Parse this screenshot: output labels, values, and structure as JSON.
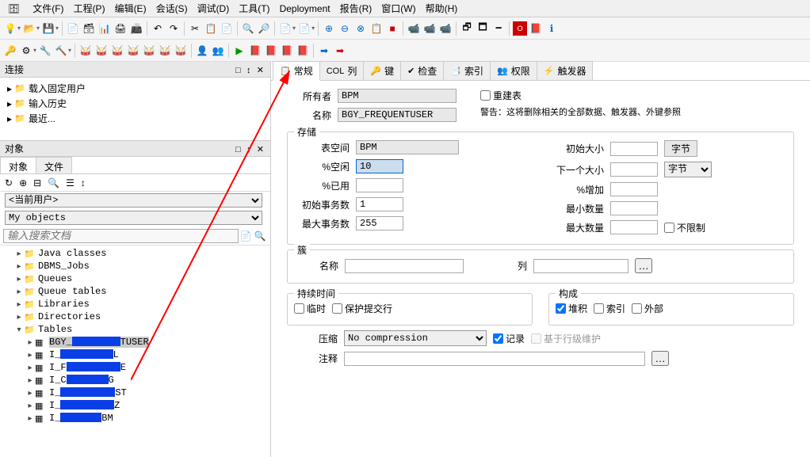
{
  "menus": [
    "文件(F)",
    "工程(P)",
    "编辑(E)",
    "会话(S)",
    "调试(D)",
    "工具(T)",
    "Deployment",
    "报告(R)",
    "窗口(W)",
    "帮助(H)"
  ],
  "panel_conn_title": "连接",
  "conn_items": [
    {
      "label": "载入固定用户"
    },
    {
      "label": "输入历史"
    },
    {
      "label": "最近..."
    }
  ],
  "obj_panel_title": "对象",
  "obj_tabs": [
    "对象",
    "文件"
  ],
  "obj_scope": "<当前用户>",
  "obj_myobjects": "My objects",
  "obj_search_ph": "输入搜索文档",
  "tree_top": [
    "Java classes",
    "DBMS_Jobs",
    "Queues",
    "Queue tables",
    "Libraries",
    "Directories"
  ],
  "tree_tables_label": "Tables",
  "tree_tables": [
    {
      "label": "BGY_",
      "tail": "TUSER",
      "sel": true
    },
    {
      "label": "I_",
      "tail": "L"
    },
    {
      "label": "I_F",
      "tail": "E"
    },
    {
      "label": "I_C",
      "tail": "G"
    },
    {
      "label": "I_",
      "tail": "ST"
    },
    {
      "label": "I_",
      "tail": "Z"
    },
    {
      "label": "I_",
      "tail": "BM"
    }
  ],
  "tabs": [
    {
      "icon": "📋",
      "label": "常规",
      "active": true
    },
    {
      "icon": "COL",
      "label": "列"
    },
    {
      "icon": "🔑",
      "label": "键"
    },
    {
      "icon": "✔",
      "label": "检查"
    },
    {
      "icon": "📑",
      "label": "索引"
    },
    {
      "icon": "👥",
      "label": "权限"
    },
    {
      "icon": "⚡",
      "label": "触发器"
    }
  ],
  "form": {
    "owner_lbl": "所有者",
    "owner_val": "BPM",
    "name_lbl": "名称",
    "name_val": "BGY_FREQUENTUSER",
    "rebuild_lbl": "重建表",
    "warn": "警告：这将删除相关的全部数据、触发器、外键参照",
    "storage_lbl": "存储",
    "tablespace_lbl": "表空间",
    "tablespace_val": "BPM",
    "initsize_lbl": "初始大小",
    "initsize_unit": "字节",
    "free_lbl": "%空闲",
    "free_val": "10",
    "next_lbl": "下一个大小",
    "next_unit": "字节",
    "used_lbl": "%已用",
    "incr_lbl": "%增加",
    "inittx_lbl": "初始事务数",
    "inittx_val": "1",
    "minext_lbl": "最小数量",
    "maxtx_lbl": "最大事务数",
    "maxtx_val": "255",
    "maxext_lbl": "最大数量",
    "unlimited_lbl": "不限制",
    "cluster_lbl": "簇",
    "cluster_name_lbl": "名称",
    "cluster_col_lbl": "列",
    "duration_lbl": "持续时间",
    "temp_lbl": "临时",
    "preserve_lbl": "保护提交行",
    "compose_lbl": "构成",
    "heap_lbl": "堆积",
    "index_lbl": "索引",
    "external_lbl": "外部",
    "compress_lbl": "压缩",
    "compress_val": "No compression",
    "log_lbl": "记录",
    "rowdep_lbl": "基于行级维护",
    "comment_lbl": "注释"
  }
}
